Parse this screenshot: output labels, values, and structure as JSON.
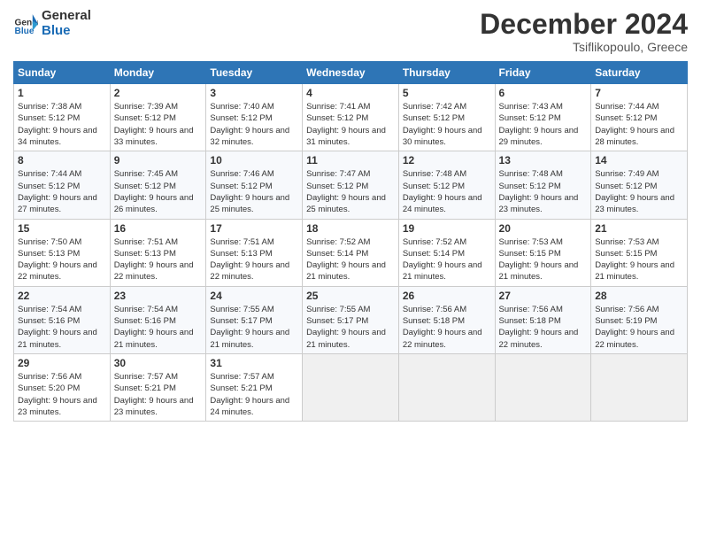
{
  "header": {
    "logo_general": "General",
    "logo_blue": "Blue",
    "title": "December 2024",
    "location": "Tsiflikopoulo, Greece"
  },
  "weekdays": [
    "Sunday",
    "Monday",
    "Tuesday",
    "Wednesday",
    "Thursday",
    "Friday",
    "Saturday"
  ],
  "weeks": [
    [
      {
        "day": "1",
        "sunrise": "Sunrise: 7:38 AM",
        "sunset": "Sunset: 5:12 PM",
        "daylight": "Daylight: 9 hours and 34 minutes."
      },
      {
        "day": "2",
        "sunrise": "Sunrise: 7:39 AM",
        "sunset": "Sunset: 5:12 PM",
        "daylight": "Daylight: 9 hours and 33 minutes."
      },
      {
        "day": "3",
        "sunrise": "Sunrise: 7:40 AM",
        "sunset": "Sunset: 5:12 PM",
        "daylight": "Daylight: 9 hours and 32 minutes."
      },
      {
        "day": "4",
        "sunrise": "Sunrise: 7:41 AM",
        "sunset": "Sunset: 5:12 PM",
        "daylight": "Daylight: 9 hours and 31 minutes."
      },
      {
        "day": "5",
        "sunrise": "Sunrise: 7:42 AM",
        "sunset": "Sunset: 5:12 PM",
        "daylight": "Daylight: 9 hours and 30 minutes."
      },
      {
        "day": "6",
        "sunrise": "Sunrise: 7:43 AM",
        "sunset": "Sunset: 5:12 PM",
        "daylight": "Daylight: 9 hours and 29 minutes."
      },
      {
        "day": "7",
        "sunrise": "Sunrise: 7:44 AM",
        "sunset": "Sunset: 5:12 PM",
        "daylight": "Daylight: 9 hours and 28 minutes."
      }
    ],
    [
      {
        "day": "8",
        "sunrise": "Sunrise: 7:44 AM",
        "sunset": "Sunset: 5:12 PM",
        "daylight": "Daylight: 9 hours and 27 minutes."
      },
      {
        "day": "9",
        "sunrise": "Sunrise: 7:45 AM",
        "sunset": "Sunset: 5:12 PM",
        "daylight": "Daylight: 9 hours and 26 minutes."
      },
      {
        "day": "10",
        "sunrise": "Sunrise: 7:46 AM",
        "sunset": "Sunset: 5:12 PM",
        "daylight": "Daylight: 9 hours and 25 minutes."
      },
      {
        "day": "11",
        "sunrise": "Sunrise: 7:47 AM",
        "sunset": "Sunset: 5:12 PM",
        "daylight": "Daylight: 9 hours and 25 minutes."
      },
      {
        "day": "12",
        "sunrise": "Sunrise: 7:48 AM",
        "sunset": "Sunset: 5:12 PM",
        "daylight": "Daylight: 9 hours and 24 minutes."
      },
      {
        "day": "13",
        "sunrise": "Sunrise: 7:48 AM",
        "sunset": "Sunset: 5:12 PM",
        "daylight": "Daylight: 9 hours and 23 minutes."
      },
      {
        "day": "14",
        "sunrise": "Sunrise: 7:49 AM",
        "sunset": "Sunset: 5:12 PM",
        "daylight": "Daylight: 9 hours and 23 minutes."
      }
    ],
    [
      {
        "day": "15",
        "sunrise": "Sunrise: 7:50 AM",
        "sunset": "Sunset: 5:13 PM",
        "daylight": "Daylight: 9 hours and 22 minutes."
      },
      {
        "day": "16",
        "sunrise": "Sunrise: 7:51 AM",
        "sunset": "Sunset: 5:13 PM",
        "daylight": "Daylight: 9 hours and 22 minutes."
      },
      {
        "day": "17",
        "sunrise": "Sunrise: 7:51 AM",
        "sunset": "Sunset: 5:13 PM",
        "daylight": "Daylight: 9 hours and 22 minutes."
      },
      {
        "day": "18",
        "sunrise": "Sunrise: 7:52 AM",
        "sunset": "Sunset: 5:14 PM",
        "daylight": "Daylight: 9 hours and 21 minutes."
      },
      {
        "day": "19",
        "sunrise": "Sunrise: 7:52 AM",
        "sunset": "Sunset: 5:14 PM",
        "daylight": "Daylight: 9 hours and 21 minutes."
      },
      {
        "day": "20",
        "sunrise": "Sunrise: 7:53 AM",
        "sunset": "Sunset: 5:15 PM",
        "daylight": "Daylight: 9 hours and 21 minutes."
      },
      {
        "day": "21",
        "sunrise": "Sunrise: 7:53 AM",
        "sunset": "Sunset: 5:15 PM",
        "daylight": "Daylight: 9 hours and 21 minutes."
      }
    ],
    [
      {
        "day": "22",
        "sunrise": "Sunrise: 7:54 AM",
        "sunset": "Sunset: 5:16 PM",
        "daylight": "Daylight: 9 hours and 21 minutes."
      },
      {
        "day": "23",
        "sunrise": "Sunrise: 7:54 AM",
        "sunset": "Sunset: 5:16 PM",
        "daylight": "Daylight: 9 hours and 21 minutes."
      },
      {
        "day": "24",
        "sunrise": "Sunrise: 7:55 AM",
        "sunset": "Sunset: 5:17 PM",
        "daylight": "Daylight: 9 hours and 21 minutes."
      },
      {
        "day": "25",
        "sunrise": "Sunrise: 7:55 AM",
        "sunset": "Sunset: 5:17 PM",
        "daylight": "Daylight: 9 hours and 21 minutes."
      },
      {
        "day": "26",
        "sunrise": "Sunrise: 7:56 AM",
        "sunset": "Sunset: 5:18 PM",
        "daylight": "Daylight: 9 hours and 22 minutes."
      },
      {
        "day": "27",
        "sunrise": "Sunrise: 7:56 AM",
        "sunset": "Sunset: 5:18 PM",
        "daylight": "Daylight: 9 hours and 22 minutes."
      },
      {
        "day": "28",
        "sunrise": "Sunrise: 7:56 AM",
        "sunset": "Sunset: 5:19 PM",
        "daylight": "Daylight: 9 hours and 22 minutes."
      }
    ],
    [
      {
        "day": "29",
        "sunrise": "Sunrise: 7:56 AM",
        "sunset": "Sunset: 5:20 PM",
        "daylight": "Daylight: 9 hours and 23 minutes."
      },
      {
        "day": "30",
        "sunrise": "Sunrise: 7:57 AM",
        "sunset": "Sunset: 5:21 PM",
        "daylight": "Daylight: 9 hours and 23 minutes."
      },
      {
        "day": "31",
        "sunrise": "Sunrise: 7:57 AM",
        "sunset": "Sunset: 5:21 PM",
        "daylight": "Daylight: 9 hours and 24 minutes."
      },
      null,
      null,
      null,
      null
    ]
  ]
}
